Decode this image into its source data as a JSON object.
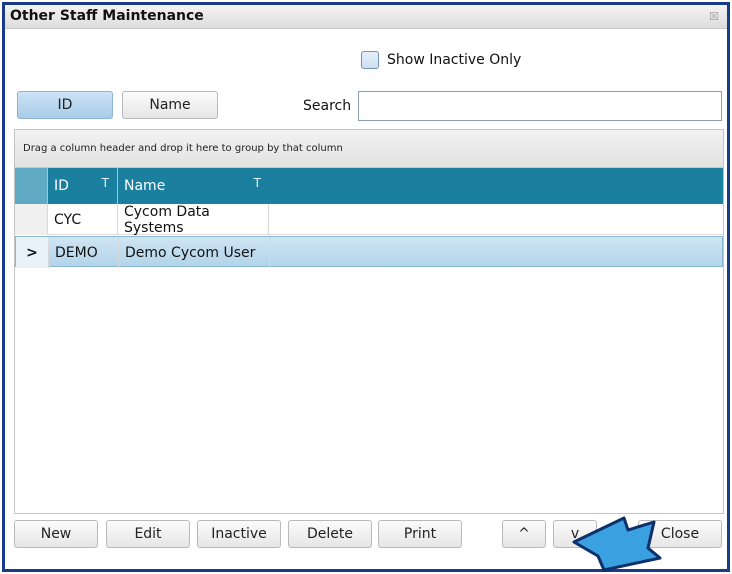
{
  "window": {
    "title": "Other Staff Maintenance",
    "close_glyph": "☒"
  },
  "filters": {
    "show_inactive_label": "Show Inactive Only",
    "show_inactive_checked": false
  },
  "toggles": {
    "id_label": "ID",
    "name_label": "Name"
  },
  "search": {
    "label": "Search",
    "value": ""
  },
  "grid": {
    "group_hint": "Drag a column header and drop it here to group by that column",
    "columns": [
      "ID",
      "Name"
    ],
    "filter_icon": "T",
    "rows": [
      {
        "indicator": "",
        "id": "CYC",
        "name": "Cycom Data Systems"
      },
      {
        "indicator": ">",
        "id": "DEMO",
        "name": "Demo Cycom User"
      }
    ]
  },
  "footer": {
    "new_label": "New",
    "edit_label": "Edit",
    "inactive_label": "Inactive",
    "delete_label": "Delete",
    "print_label": "Print",
    "up_label": "^",
    "down_label": "v",
    "close_label": "Close"
  },
  "colors": {
    "header": "#1b7f9f",
    "selected_row": "#b3d4ea",
    "window_border": "#1a3a8a",
    "arrow": "#3aa0e0"
  }
}
